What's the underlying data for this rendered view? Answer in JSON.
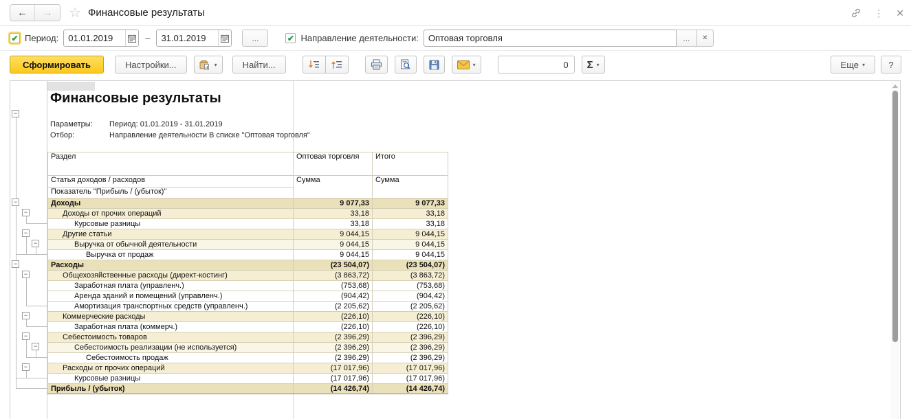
{
  "titlebar": {
    "back_icon": "←",
    "forward_icon": "→",
    "star_icon": "☆",
    "title": "Финансовые результаты",
    "menu_icon": "⋮",
    "close_icon": "✕"
  },
  "filters": {
    "period": {
      "checked": true,
      "label": "Период:",
      "from": "01.01.2019",
      "dash": "–",
      "to": "31.01.2019",
      "more_label": "..."
    },
    "direction": {
      "checked": true,
      "label": "Направление деятельности:",
      "value": "Оптовая торговля",
      "more_label": "...",
      "clear_icon": "✕"
    }
  },
  "toolbar": {
    "generate_label": "Сформировать",
    "settings_label": "Настройки...",
    "find_label": "Найти...",
    "counter_value": "0",
    "sigma_label": "Σ",
    "caret": "▾",
    "more_label": "Еще",
    "help_label": "?"
  },
  "report": {
    "title": "Финансовые результаты",
    "params": [
      {
        "label": "Параметры:",
        "value": "Период: 01.01.2019 - 31.01.2019"
      },
      {
        "label": "Отбор:",
        "value": "Направление деятельности В списке \"Оптовая торговля\""
      }
    ],
    "outer_group": {
      "minus": "−",
      "group_end": 18
    },
    "table": {
      "header": {
        "col1": [
          "Раздел",
          "Статья доходов / расходов",
          "Показатель \"Прибыль / (убыток)\""
        ],
        "col2": [
          "Оптовая торговля",
          "Сумма"
        ],
        "col3": [
          "Итого",
          "Сумма"
        ]
      },
      "rows": [
        {
          "label": "Доходы",
          "indent": 0,
          "style": "g1",
          "box": 1,
          "group_end": 5,
          "values": [
            "9 077,33",
            "9 077,33"
          ]
        },
        {
          "label": "Доходы от прочих операций",
          "indent": 1,
          "style": "g2",
          "box": 2,
          "group_end": 2,
          "values": [
            "33,18",
            "33,18"
          ]
        },
        {
          "label": "Курсовые разницы",
          "indent": 2,
          "style": "leaf",
          "values": [
            "33,18",
            "33,18"
          ]
        },
        {
          "label": "Другие статьи",
          "indent": 1,
          "style": "g2",
          "box": 2,
          "group_end": 5,
          "values": [
            "9 044,15",
            "9 044,15"
          ]
        },
        {
          "label": "Выручка от обычной деятельности",
          "indent": 2,
          "style": "g3",
          "box": 3,
          "group_end": 5,
          "values": [
            "9 044,15",
            "9 044,15"
          ]
        },
        {
          "label": "Выручка от продаж",
          "indent": 3,
          "style": "leaf",
          "values": [
            "9 044,15",
            "9 044,15"
          ]
        },
        {
          "label": "Расходы",
          "indent": 0,
          "style": "g1",
          "box": 1,
          "group_end": 17,
          "values": [
            "(23 504,07)",
            "(23 504,07)"
          ]
        },
        {
          "label": "Общехозяйственные расходы (директ-костинг)",
          "indent": 1,
          "style": "g2",
          "box": 2,
          "group_end": 10,
          "values": [
            "(3 863,72)",
            "(3 863,72)"
          ]
        },
        {
          "label": "Заработная плата (управленч.)",
          "indent": 2,
          "style": "leaf",
          "values": [
            "(753,68)",
            "(753,68)"
          ]
        },
        {
          "label": "Аренда зданий и помещений (управленч.)",
          "indent": 2,
          "style": "leaf",
          "values": [
            "(904,42)",
            "(904,42)"
          ]
        },
        {
          "label": "Амортизация транспортных средств (управленч.)",
          "indent": 2,
          "style": "leaf",
          "values": [
            "(2 205,62)",
            "(2 205,62)"
          ]
        },
        {
          "label": "Коммерческие расходы",
          "indent": 1,
          "style": "g2",
          "box": 2,
          "group_end": 12,
          "values": [
            "(226,10)",
            "(226,10)"
          ]
        },
        {
          "label": "Заработная плата (коммерч.)",
          "indent": 2,
          "style": "leaf",
          "values": [
            "(226,10)",
            "(226,10)"
          ]
        },
        {
          "label": "Себестоимость товаров",
          "indent": 1,
          "style": "g2",
          "box": 2,
          "group_end": 15,
          "values": [
            "(2 396,29)",
            "(2 396,29)"
          ]
        },
        {
          "label": "Себестоимость реализации (не используется)",
          "indent": 2,
          "style": "g3",
          "box": 3,
          "group_end": 15,
          "values": [
            "(2 396,29)",
            "(2 396,29)"
          ]
        },
        {
          "label": "Себестоимость продаж",
          "indent": 3,
          "style": "leaf",
          "values": [
            "(2 396,29)",
            "(2 396,29)"
          ]
        },
        {
          "label": "Расходы от прочих операций",
          "indent": 1,
          "style": "g2",
          "box": 2,
          "group_end": 17,
          "values": [
            "(17 017,96)",
            "(17 017,96)"
          ]
        },
        {
          "label": "Курсовые разницы",
          "indent": 2,
          "style": "leaf",
          "values": [
            "(17 017,96)",
            "(17 017,96)"
          ]
        },
        {
          "label": "Прибыль / (убыток)",
          "indent": 0,
          "style": "g1",
          "values": [
            "(14 426,74)",
            "(14 426,74)"
          ]
        }
      ]
    }
  },
  "colors": {
    "accent_yellow": "#fbc81e",
    "header_beige": "#f2e9c8",
    "group_beige": "#eae0b9",
    "group_light": "#f5eed3",
    "group_lighter": "#faf6e6",
    "check_green": "#1e9e3e",
    "icon_orange": "#e08a2e",
    "save_blue": "#4a7ab5",
    "mail_yellow": "#f0b53c"
  }
}
